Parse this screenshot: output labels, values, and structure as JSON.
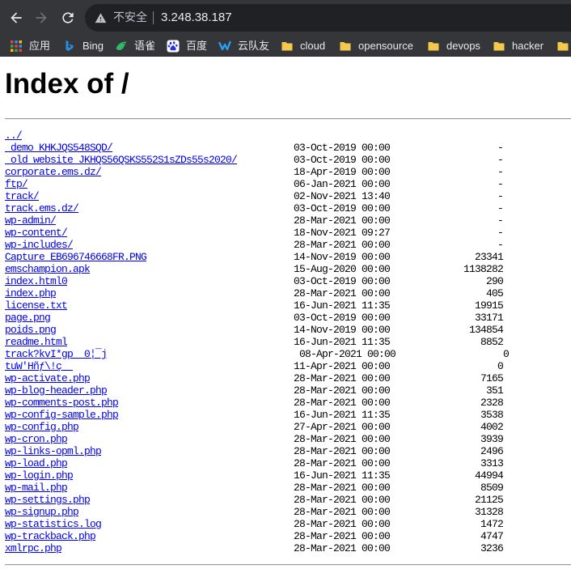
{
  "browser": {
    "security_label": "不安全",
    "url": "3.248.38.187"
  },
  "bookmarks": [
    {
      "label": "应用",
      "icon": "apps-grid-icon"
    },
    {
      "label": "Bing",
      "icon": "bing-icon"
    },
    {
      "label": "语雀",
      "icon": "yuque-icon"
    },
    {
      "label": "百度",
      "icon": "baidu-icon"
    },
    {
      "label": "云队友",
      "icon": "yunduiyou-icon"
    },
    {
      "label": "cloud",
      "icon": "folder-icon"
    },
    {
      "label": "opensource",
      "icon": "folder-icon"
    },
    {
      "label": "devops",
      "icon": "folder-icon"
    },
    {
      "label": "hacker",
      "icon": "folder-icon"
    },
    {
      "icon": "folder-icon"
    }
  ],
  "page": {
    "title": "Index of /",
    "entries": [
      {
        "name": "../"
      },
      {
        "name": "_demo_KHKJQS548SQD/",
        "date": "03-Oct-2019 00:00",
        "size": "-"
      },
      {
        "name": "_old_website_JKHQS56QSKS552S1sZDs55s2020/",
        "date": "03-Oct-2019 00:00",
        "size": "-"
      },
      {
        "name": "corporate.ems.dz/",
        "date": "18-Apr-2019 00:00",
        "size": "-"
      },
      {
        "name": "ftp/",
        "date": "06-Jan-2021 00:00",
        "size": "-"
      },
      {
        "name": "track/",
        "date": "02-Nov-2021 13:40",
        "size": "-"
      },
      {
        "name": "track.ems.dz/",
        "date": "03-Oct-2019 00:00",
        "size": "-"
      },
      {
        "name": "wp-admin/",
        "date": "28-Mar-2021 00:00",
        "size": "-"
      },
      {
        "name": "wp-content/",
        "date": "18-Nov-2021 09:27",
        "size": "-"
      },
      {
        "name": "wp-includes/",
        "date": "28-Mar-2021 00:00",
        "size": "-"
      },
      {
        "name": "Capture_EB696746668FR.PNG",
        "date": "14-Nov-2019 00:00",
        "size": "23341"
      },
      {
        "name": "emschampion.apk",
        "date": "15-Aug-2020 00:00",
        "size": "1138282"
      },
      {
        "name": "index.html0",
        "date": "03-Oct-2019 00:00",
        "size": "290"
      },
      {
        "name": "index.php",
        "date": "28-Mar-2021 00:00",
        "size": "405"
      },
      {
        "name": "license.txt",
        "date": "16-Jun-2021 11:35",
        "size": "19915"
      },
      {
        "name": "page.png",
        "date": "03-Oct-2019 00:00",
        "size": "33171"
      },
      {
        "name": "poids.png",
        "date": "14-Nov-2019 00:00",
        "size": "134854"
      },
      {
        "name": "readme.html",
        "date": "16-Jun-2021 11:35",
        "size": "8852"
      },
      {
        "name": "track?kvI*gp  0¦¯j",
        "date": "08-Apr-2021 00:00",
        "size": "0"
      },
      {
        "name": "tuW'Hñƒ\\!ç  ",
        "date": "11-Apr-2021 00:00",
        "size": "0"
      },
      {
        "name": "wp-activate.php",
        "date": "28-Mar-2021 00:00",
        "size": "7165"
      },
      {
        "name": "wp-blog-header.php",
        "date": "28-Mar-2021 00:00",
        "size": "351"
      },
      {
        "name": "wp-comments-post.php",
        "date": "28-Mar-2021 00:00",
        "size": "2328"
      },
      {
        "name": "wp-config-sample.php",
        "date": "16-Jun-2021 11:35",
        "size": "3538"
      },
      {
        "name": "wp-config.php",
        "date": "27-Apr-2021 00:00",
        "size": "4002"
      },
      {
        "name": "wp-cron.php",
        "date": "28-Mar-2021 00:00",
        "size": "3939"
      },
      {
        "name": "wp-links-opml.php",
        "date": "28-Mar-2021 00:00",
        "size": "2496"
      },
      {
        "name": "wp-load.php",
        "date": "28-Mar-2021 00:00",
        "size": "3313"
      },
      {
        "name": "wp-login.php",
        "date": "16-Jun-2021 11:35",
        "size": "44994"
      },
      {
        "name": "wp-mail.php",
        "date": "28-Mar-2021 00:00",
        "size": "8509"
      },
      {
        "name": "wp-settings.php",
        "date": "28-Mar-2021 00:00",
        "size": "21125"
      },
      {
        "name": "wp-signup.php",
        "date": "28-Mar-2021 00:00",
        "size": "31328"
      },
      {
        "name": "wp-statistics.log",
        "date": "28-Mar-2021 00:00",
        "size": "1472"
      },
      {
        "name": "wp-trackback.php",
        "date": "28-Mar-2021 00:00",
        "size": "4747"
      },
      {
        "name": "xmlrpc.php",
        "date": "28-Mar-2021 00:00",
        "size": "3236"
      }
    ]
  },
  "colors": {
    "toolbar": "#35363a",
    "omnibox": "#202124",
    "link": "#0000ee",
    "folder": "#f2c94c"
  }
}
